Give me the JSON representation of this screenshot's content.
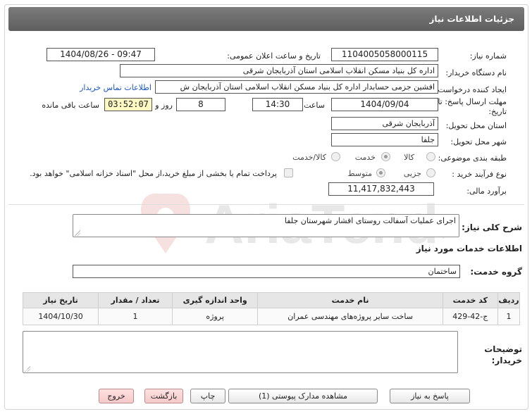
{
  "title": "جزئیات اطلاعات نیاز",
  "fields": {
    "need_number_label": "شماره نیاز:",
    "need_number": "1104005058000115",
    "announce_label": "تاریخ و ساعت اعلان عمومی:",
    "announce_value": "1404/08/26 - 09:47",
    "buyer_org_label": "نام دستگاه خریدار:",
    "buyer_org": "اداره کل بنیاد مسکن انقلاب اسلامی استان آذربایجان شرقی",
    "creator_label": "ایجاد کننده درخواست:",
    "creator": "افشین جزمی حسابدار اداره کل بنیاد مسکن انقلاب اسلامی استان آذربایجان ش",
    "contact_link": "اطلاعات تماس خریدار",
    "deadline_label": "مهلت ارسال پاسخ: تا تاریخ:",
    "deadline_date": "1404/09/04",
    "time_label": "ساعت",
    "deadline_time": "14:30",
    "days": "8",
    "days_label": "روز و",
    "remaining": "03:52:07",
    "remaining_label": "ساعت باقی مانده",
    "province_label": "استان محل تحویل:",
    "province": "آذربایجان شرقی",
    "city_label": "شهر محل تحویل:",
    "city": "جلفا",
    "category_label": "طبقه بندی موضوعی:",
    "category_options": [
      "کالا",
      "خدمت",
      "کالا/خدمت"
    ],
    "category_selected": "خدمت",
    "process_label": "نوع فرآیند خرید :",
    "process_options": [
      "جزیی",
      "متوسط"
    ],
    "process_selected": "متوسط",
    "payment_note": "پرداخت تمام یا بخشی از مبلغ خرید،از محل \"اسناد خزانه اسلامی\" خواهد بود.",
    "budget_label": "برآورد مالی:",
    "budget": "11,417,832,443"
  },
  "summary": {
    "label": "شرح کلی نیاز:",
    "text": "اجرای عملیات آسفالت روستای افشار شهرستان جلفا"
  },
  "services": {
    "heading": "اطلاعات خدمات مورد نیاز",
    "group_label": "گروه خدمت:",
    "group_value": "ساختمان",
    "columns": [
      "ردیف",
      "کد خدمت",
      "نام خدمت",
      "واحد اندازه گیری",
      "تعداد / مقدار",
      "تاریخ نیاز"
    ],
    "rows": [
      [
        "1",
        "ج-42-429",
        "ساخت سایر پروژه‌های مهندسی عمران",
        "پروژه",
        "1",
        "1404/10/30"
      ]
    ]
  },
  "buyer_notes": {
    "label": "توضیحات خریدار:",
    "text": ""
  },
  "buttons": {
    "reply": "پاسخ به نیاز",
    "view_docs": "مشاهده مدارک پیوستی (1)",
    "print": "چاپ",
    "back": "بازگشت",
    "exit": "خروج"
  },
  "watermark_text": "AriaTender.net",
  "colors": {
    "title_bar": "#6b6b6b",
    "link": "#1a56c6",
    "remaining_bg": "#fef9c3",
    "pink_button": "#f6c9c9"
  }
}
